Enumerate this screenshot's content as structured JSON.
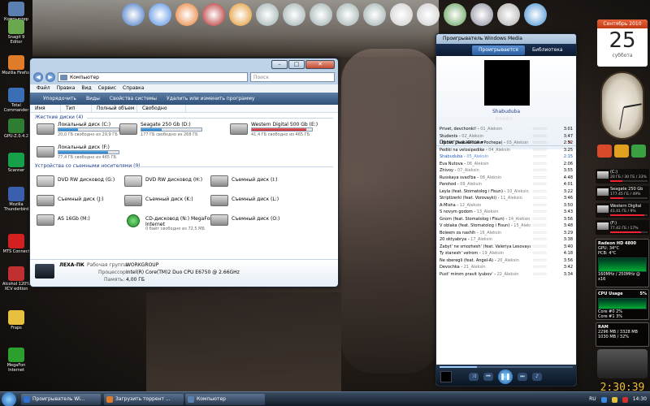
{
  "desktop": {
    "icons": [
      {
        "label": "Компьютер",
        "color": "#5b7fb0"
      },
      {
        "label": "Snagit 9 Editor",
        "color": "#6aa84f"
      },
      {
        "label": "Mozilla Firefox",
        "color": "#e07b2a"
      },
      {
        "label": "Total Commander",
        "color": "#3b6fb5"
      },
      {
        "label": "GPU-Z.0.4.2",
        "color": "#2f7d32"
      },
      {
        "label": "Scanner",
        "color": "#16a04a"
      },
      {
        "label": "Mozilla Thunderbird",
        "color": "#3a5fae"
      },
      {
        "label": "MTS Connect",
        "color": "#d42020"
      },
      {
        "label": "Alcohol 120% XCV edition",
        "color": "#c03030"
      },
      {
        "label": "Fraps",
        "color": "#e8c040"
      },
      {
        "label": "MegaFon Internet",
        "color": "#2ca02c"
      }
    ]
  },
  "dock": {
    "items": [
      "wmp-orb-icon",
      "network-globe-icon",
      "firefox-icon",
      "spider-icon",
      "media-play-icon",
      "hdd-icon-1",
      "hdd-icon-2",
      "hdd-icon-3",
      "hdd-icon-4",
      "hdd-icon-5",
      "dvd-icon-1",
      "dvd-icon-2",
      "monitor-icon",
      "recycle-icon",
      "calculator-icon",
      "globe-icon"
    ],
    "labels": {
      "dvd1": "DVD",
      "dvd2": "DVD"
    }
  },
  "explorer": {
    "address": "Компьютер",
    "search_placeholder": "Поиск",
    "menu": [
      "Файл",
      "Правка",
      "Вид",
      "Сервис",
      "Справка"
    ],
    "toolbar": [
      "Упорядочить",
      "Виды",
      "Свойства системы",
      "Удалить или изменить программу"
    ],
    "columns": [
      "Имя",
      "Тип",
      "Полный объем",
      "Свободно"
    ],
    "group_hdd": "Жесткие диски (4)",
    "group_removable": "Устройства со съемными носителями (9)",
    "hdd": [
      {
        "name": "Локальный диск (C:)",
        "free": "20,0 ГБ свободно из 29,9 ГБ",
        "used": 0.33,
        "critical": false
      },
      {
        "name": "Seagate 250 Gb (D:)",
        "free": "177 ГБ свободно из 268 ГБ",
        "used": 0.34,
        "critical": false
      },
      {
        "name": "Western Digital 500 Gb (E:)",
        "free": "41,4 ГБ свободно из 465 ГБ",
        "used": 0.91,
        "critical": true
      },
      {
        "name": "Локальный диск (F:)",
        "free": "77,4 ГБ свободно из 465 ГБ",
        "used": 0.83,
        "critical": false
      }
    ],
    "removable": [
      {
        "name": "DVD RW дисковод (G:)",
        "free": "",
        "kind": "dvd"
      },
      {
        "name": "DVD RW дисковод (H:)",
        "free": "",
        "kind": "dvd"
      },
      {
        "name": "Съемный диск (I:)",
        "free": "",
        "kind": "rem"
      },
      {
        "name": "Съемный диск (J:)",
        "free": "",
        "kind": "rem"
      },
      {
        "name": "Съемный диск (K:)",
        "free": "",
        "kind": "rem"
      },
      {
        "name": "Съемный диск (L:)",
        "free": "",
        "kind": "rem"
      },
      {
        "name": "AS 16Gb (M:)",
        "free": "",
        "kind": "rem"
      },
      {
        "name": "CD-дисковод (N:) MegaFon Internet",
        "free": "0 байт свободно из 72,5 МБ",
        "kind": "mega"
      },
      {
        "name": "Съемный диск (O:)",
        "free": "",
        "kind": "rem"
      }
    ],
    "details": {
      "name": "ЛЕХА-ПК",
      "workgroup_label": "Рабочая группа:",
      "workgroup": "WORKGROUP",
      "cpu_label": "Процессор:",
      "cpu": "Intel(R) Core(TM)2 Duo CPU    E6750 @ 2.66GHz",
      "mem_label": "Память:",
      "mem": "4,00 ГБ"
    }
  },
  "wmp": {
    "title": "Проигрыватель Windows Media",
    "tab_now": "Проигрывается",
    "tab_lib": "Библиотека",
    "album_caption": "Shabuduba",
    "now_header": "Проигрывается",
    "tracks": [
      {
        "title": "Privet, devchonki!",
        "artist": "01_Aleksin",
        "dur": "3:01",
        "current": false
      },
      {
        "title": "Students",
        "artist": "02_Aleksin",
        "dur": "3:47",
        "current": false
      },
      {
        "title": "Lifchiki (feat. Oksana Pochepa)",
        "artist": "03_Aleksin",
        "dur": "2:52",
        "current": false
      },
      {
        "title": "Pediki na velosipedike",
        "artist": "04_Aleksin",
        "dur": "3:25",
        "current": false
      },
      {
        "title": "Shabuduba",
        "artist": "05_Aleksin",
        "dur": "2:15",
        "current": true
      },
      {
        "title": "Eva Nutova",
        "artist": "06_Aleksin",
        "dur": "2:06",
        "current": false
      },
      {
        "title": "Zhivoy",
        "artist": "07_Aleksin",
        "dur": "3:55",
        "current": false
      },
      {
        "title": "Russkaya svad'ba",
        "artist": "08_Aleksin",
        "dur": "4:48",
        "current": false
      },
      {
        "title": "Parohod",
        "artist": "09_Aleksin",
        "dur": "4:01",
        "current": false
      },
      {
        "title": "Leyla (feat. Stomatolog i Fisun)",
        "artist": "10_Aleksin",
        "dur": "3:22",
        "current": false
      },
      {
        "title": "Striptizerki (feat. Vorovayki)",
        "artist": "11_Aleksin",
        "dur": "3:46",
        "current": false
      },
      {
        "title": "A-Misha",
        "artist": "12_Aleksin",
        "dur": "3:50",
        "current": false
      },
      {
        "title": "S novym godom",
        "artist": "13_Aleksin",
        "dur": "3:43",
        "current": false
      },
      {
        "title": "Gnom (feat. Stomatolog i Fisun)",
        "artist": "14_Aleksin",
        "dur": "3:56",
        "current": false
      },
      {
        "title": "V oblaka (feat. Stomatolog i Fisun)",
        "artist": "15_Aleksin",
        "dur": "3:48",
        "current": false
      },
      {
        "title": "Boleem za nashih",
        "artist": "16_Aleksin",
        "dur": "3:29",
        "current": false
      },
      {
        "title": "20 oktyabrya",
        "artist": "17_Aleksin",
        "dur": "3:38",
        "current": false
      },
      {
        "title": "Zabyt' ne smozhesh' (feat. Valeriya Lesovaya)",
        "artist": "18_Aleksin",
        "dur": "3:40",
        "current": false
      },
      {
        "title": "Ty stanesh' vetrom",
        "artist": "19_Aleksin",
        "dur": "4:18",
        "current": false
      },
      {
        "title": "Ne sberegli (feat. Angel-A)",
        "artist": "20_Aleksin",
        "dur": "3:56",
        "current": false
      },
      {
        "title": "Devochka",
        "artist": "21_Aleksin",
        "dur": "3:42",
        "current": false
      },
      {
        "title": "Pust' mirom pravit lyubov'",
        "artist": "22_Aleksin",
        "dur": "3:34",
        "current": false
      }
    ],
    "progress": 0.28
  },
  "sidebar": {
    "calendar_month": "Сентябрь 2010",
    "calendar_day": "25",
    "calendar_weekday": "суббота",
    "drives": [
      {
        "name": "(C:)",
        "free": "20 ГБ / 30 ГБ / 33%",
        "used": 0.33
      },
      {
        "name": "Seagate 250 Gb",
        "free": "177.45 ГБ / 49%",
        "used": 0.34
      },
      {
        "name": "Western Digital",
        "free": "41.41 ГБ / 9%",
        "used": 0.91
      },
      {
        "name": "(F:)",
        "free": "77.42 ГБ / 17%",
        "used": 0.83
      }
    ],
    "gpu_title": "Radeon HD 4800",
    "gpu_temp": "GPU: 34°C",
    "gpu_pcb": "PCB: 4°C",
    "gpu_clock": "160MHz / 250MHz @ x16",
    "cpu_title": "CPU Usage",
    "cpu_total": "5%",
    "cpu_core0": "Core #0  2%",
    "cpu_core1": "Core #1  3%",
    "ram_title": "RAM",
    "ram_line1": "2296 MB / 3328 MB",
    "ram_line2": "1030 MB / 32%",
    "digital_clock": "2:30:39"
  },
  "taskbar": {
    "buttons": [
      {
        "label": "Проигрыватель Wi...",
        "color": "#2f6fd0"
      },
      {
        "label": "Загрузить торрент ...",
        "color": "#e07b2a"
      },
      {
        "label": "Компьютер",
        "color": "#5b7fb0"
      }
    ],
    "lang": "RU",
    "time": "14:30"
  }
}
